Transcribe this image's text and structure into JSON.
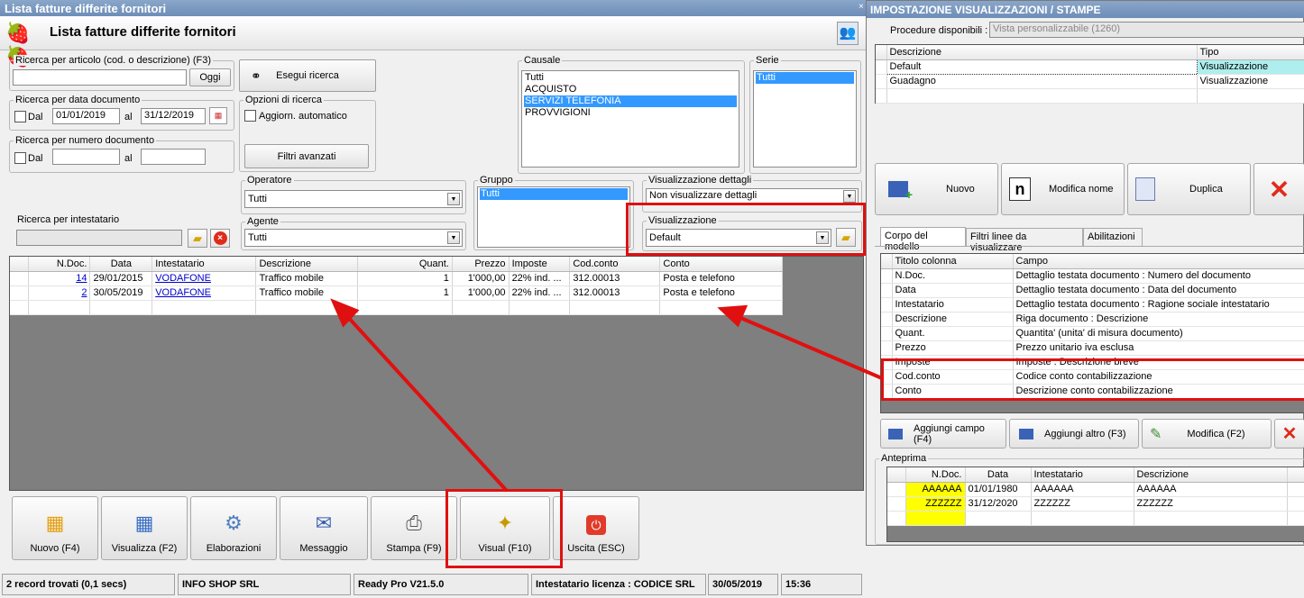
{
  "main_window": {
    "title": "Lista fatture differite fornitori",
    "header_title": "Lista fatture differite fornitori",
    "search_article": {
      "label": "Ricerca per articolo (cod. o descrizione) (F3)",
      "value": "",
      "today_button": "Oggi"
    },
    "search_date": {
      "label": "Ricerca per data documento",
      "from_label": "Dal",
      "from_value": "01/01/2019",
      "to_label": "al",
      "to_value": "31/12/2019"
    },
    "search_number": {
      "label": "Ricerca per numero documento",
      "from_label": "Dal",
      "from_value": "",
      "to_label": "al",
      "to_value": ""
    },
    "search_button": "Esegui ricerca",
    "search_options": {
      "label": "Opzioni di ricerca",
      "auto_update": "Aggiorn. automatico"
    },
    "advanced_filters": "Filtri avanzati",
    "causale": {
      "label": "Causale",
      "items": [
        "Tutti",
        "ACQUISTO",
        "SERVIZI TELEFONIA",
        "PROVVIGIONI"
      ],
      "selected_index": 2
    },
    "serie": {
      "label": "Serie",
      "items": [
        "Tutti"
      ]
    },
    "operatore": {
      "label": "Operatore",
      "value": "Tutti"
    },
    "agente": {
      "label": "Agente",
      "value": "Tutti"
    },
    "gruppo": {
      "label": "Gruppo",
      "items": [
        "Tutti"
      ]
    },
    "detail_view": {
      "label": "Visualizzazione dettagli",
      "value": "Non visualizzare dettagli"
    },
    "view": {
      "label": "Visualizzazione",
      "value": "Default"
    },
    "search_holder": {
      "label": "Ricerca per intestatario",
      "value": ""
    },
    "table": {
      "columns": [
        "N.Doc.",
        "Data",
        "Intestatario",
        "Descrizione",
        "Quant.",
        "Prezzo",
        "Imposte",
        "Cod.conto",
        "Conto"
      ],
      "rows": [
        [
          "14",
          "29/01/2015",
          "VODAFONE",
          "Traffico mobile",
          "1",
          "1'000,00",
          "22% ind. ...",
          "312.00013",
          "Posta e telefono"
        ],
        [
          "2",
          "30/05/2019",
          "VODAFONE",
          "Traffico mobile",
          "1",
          "1'000,00",
          "22% ind. ...",
          "312.00013",
          "Posta e telefono"
        ]
      ]
    },
    "buttons": [
      "Nuovo (F4)",
      "Visualizza (F2)",
      "Elaborazioni",
      "Messaggio",
      "Stampa (F9)",
      "Visual (F10)",
      "Uscita (ESC)"
    ],
    "status": [
      "2 record trovati (0,1 secs)",
      "INFO SHOP SRL",
      "Ready Pro V21.5.0",
      "Intestatario licenza : CODICE SRL",
      "30/05/2019",
      "15:36"
    ]
  },
  "settings_window": {
    "title": "IMPOSTAZIONE VISUALIZZAZIONI / STAMPE",
    "procedures_label": "Procedure disponibili :",
    "procedures_value": "Vista personalizzabile (1260)",
    "views_columns": [
      "Descrizione",
      "Tipo"
    ],
    "views": [
      [
        "Default",
        "Visualizzazione"
      ],
      [
        "Guadagno",
        "Visualizzazione"
      ]
    ],
    "buttons": {
      "new": "Nuovo",
      "rename": "Modifica nome",
      "duplicate": "Duplica"
    },
    "tabs": [
      "Corpo del modello",
      "Filtri linee da visualizzare",
      "Abilitazioni"
    ],
    "fields_columns": [
      "Titolo colonna",
      "Campo"
    ],
    "fields": [
      [
        "N.Doc.",
        "Dettaglio testata documento : Numero del documento"
      ],
      [
        "Data",
        "Dettaglio testata documento : Data del documento"
      ],
      [
        "Intestatario",
        "Dettaglio testata documento : Ragione sociale intestatario"
      ],
      [
        "Descrizione",
        "Riga documento : Descrizione"
      ],
      [
        "Quant.",
        "Quantita' (unita' di misura documento)"
      ],
      [
        "Prezzo",
        "Prezzo unitario iva esclusa"
      ],
      [
        "Imposte",
        "Imposte : Descrizione breve"
      ],
      [
        "Cod.conto",
        "Codice conto contabilizzazione"
      ],
      [
        "Conto",
        "Descrizione conto contabilizzazione"
      ]
    ],
    "field_buttons": {
      "add_field": "Aggiungi campo (F4)",
      "add_other": "Aggiungi altro (F3)",
      "edit": "Modifica (F2)"
    },
    "preview": {
      "label": "Anteprima",
      "columns": [
        "N.Doc.",
        "Data",
        "Intestatario",
        "Descrizione"
      ],
      "rows": [
        [
          "AAAAAA",
          "01/01/1980",
          "AAAAAA",
          "AAAAAA"
        ],
        [
          "ZZZZZZ",
          "31/12/2020",
          "ZZZZZZ",
          "ZZZZZZ"
        ]
      ]
    }
  },
  "colors": {
    "highlight": "#e01010",
    "selection": "#3399ff",
    "link": "#0000cc",
    "yellow": "#ffff00"
  }
}
